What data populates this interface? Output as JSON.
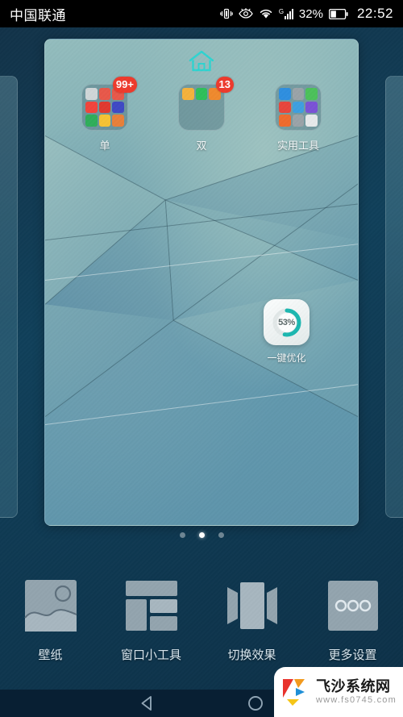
{
  "status_bar": {
    "carrier": "中国联通",
    "battery_percent": "32%",
    "clock": "22:52",
    "network_type": "G",
    "icons": [
      "vibrate-icon",
      "eye-comfort-icon",
      "wifi-icon",
      "signal-icon",
      "battery-icon"
    ]
  },
  "home_screen": {
    "home_indicator_icon": "home-icon",
    "folders": [
      {
        "label": "单",
        "badge": "99+",
        "icon_colors": [
          "#cfd6d8",
          "#e8584a",
          "#e8584a",
          "#f2443c",
          "#e0392f",
          "#3f49c4",
          "#2fae5a",
          "#f5c234",
          "#e8803a"
        ]
      },
      {
        "label": "双",
        "badge": "13",
        "icon_colors": [
          "#f5b23c",
          "#2fbf5a",
          "#ef8a2e",
          "",
          "",
          "",
          "",
          "",
          ""
        ]
      },
      {
        "label": "实用工具",
        "badge": "",
        "icon_colors": [
          "#2f8fe0",
          "#9aa3a8",
          "#4cc15a",
          "#e8463c",
          "#3e9fe0",
          "#7a52d6",
          "#ef6b2e",
          "#9aa3a8",
          "#e6e9ea"
        ]
      }
    ],
    "optimizer_widget": {
      "label": "一键优化",
      "percent_text": "53%",
      "percent_value": 53,
      "ring_color": "#1cb7b0"
    },
    "page_dots": {
      "count": 3,
      "active_index": 1
    }
  },
  "edit_toolbar": {
    "items": [
      {
        "label": "壁纸",
        "icon": "wallpaper-icon"
      },
      {
        "label": "窗口小工具",
        "icon": "widgets-icon"
      },
      {
        "label": "切换效果",
        "icon": "transition-effect-icon"
      },
      {
        "label": "更多设置",
        "icon": "more-settings-icon"
      }
    ]
  },
  "nav_bar": {
    "back_icon": "back-triangle-icon",
    "home_icon": "home-circle-icon"
  },
  "watermark": {
    "title": "飞沙系统网",
    "url": "www.fs0745.com"
  }
}
